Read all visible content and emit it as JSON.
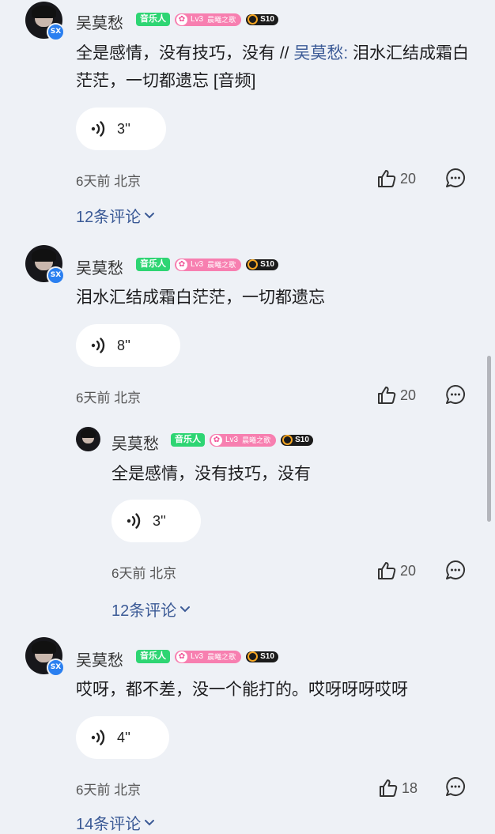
{
  "comments": [
    {
      "username": "吴莫愁",
      "badge_music": "音乐人",
      "level": "Lv3",
      "level_title": "晨曦之歌",
      "badge_s": "S10",
      "avatar_badge": "SX",
      "text_main": "全是感情，没有技巧，没有 // ",
      "mention": "吴莫愁:",
      "text_rest": " 泪水汇结成霜白茫茫，一切都遗忘 [音频]",
      "voice_duration": "3''",
      "time_location": "6天前 北京",
      "likes": "20",
      "more_replies": "12条评论"
    },
    {
      "username": "吴莫愁",
      "badge_music": "音乐人",
      "level": "Lv3",
      "level_title": "晨曦之歌",
      "badge_s": "S10",
      "avatar_badge": "SX",
      "text": "泪水汇结成霜白茫茫，一切都遗忘",
      "voice_duration": "8''",
      "time_location": "6天前 北京",
      "likes": "20"
    },
    {
      "username": "吴莫愁",
      "badge_music": "音乐人",
      "level": "Lv3",
      "level_title": "晨曦之歌",
      "badge_s": "S10",
      "text": "全是感情，没有技巧，没有",
      "voice_duration": "3''",
      "time_location": "6天前 北京",
      "likes": "20",
      "more_replies": "12条评论"
    },
    {
      "username": "吴莫愁",
      "badge_music": "音乐人",
      "level": "Lv3",
      "level_title": "晨曦之歌",
      "badge_s": "S10",
      "avatar_badge": "SX",
      "text": "哎呀，都不差，没一个能打的。哎呀呀呀哎呀",
      "voice_duration": "4''",
      "time_location": "6天前 北京",
      "likes": "18",
      "more_replies": "14条评论"
    }
  ],
  "icons": {
    "like": "thumbs-up-icon",
    "reply": "comment-bubble-icon",
    "voice": "sound-wave-icon",
    "expand": "chevron-down-icon"
  },
  "colors": {
    "background": "#eef1f6",
    "mention": "#3b5a96",
    "music_badge": "#2ed573",
    "level_badge": "#f77fb0"
  }
}
